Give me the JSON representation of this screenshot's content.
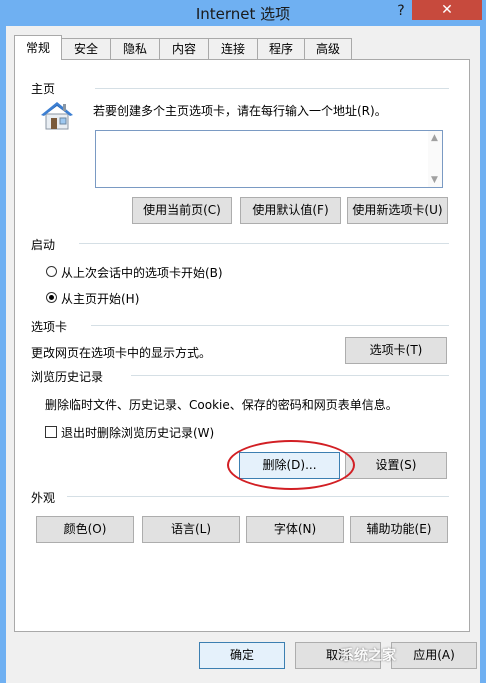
{
  "window": {
    "title": "Internet 选项",
    "help": "?",
    "close": "✕"
  },
  "tabs": [
    {
      "label": "常规",
      "active": true
    },
    {
      "label": "安全"
    },
    {
      "label": "隐私"
    },
    {
      "label": "内容"
    },
    {
      "label": "连接"
    },
    {
      "label": "程序"
    },
    {
      "label": "高级"
    }
  ],
  "homepage": {
    "section": "主页",
    "instruction": "若要创建多个主页选项卡，请在每行输入一个地址(R)。",
    "url_value": "",
    "use_current": "使用当前页(C)",
    "use_default": "使用默认值(F)",
    "use_new_tab": "使用新选项卡(U)"
  },
  "startup": {
    "section": "启动",
    "option_last_session": "从上次会话中的选项卡开始(B)",
    "option_homepage": "从主页开始(H)",
    "selected": "option_homepage"
  },
  "tabs_section": {
    "section": "选项卡",
    "description": "更改网页在选项卡中的显示方式。",
    "button": "选项卡(T)"
  },
  "history": {
    "section": "浏览历史记录",
    "description": "删除临时文件、历史记录、Cookie、保存的密码和网页表单信息。",
    "delete_on_exit": "退出时删除浏览历史记录(W)",
    "delete_on_exit_checked": false,
    "delete_button": "删除(D)...",
    "settings_button": "设置(S)"
  },
  "appearance": {
    "section": "外观",
    "colors": "颜色(O)",
    "languages": "语言(L)",
    "fonts": "字体(N)",
    "accessibility": "辅助功能(E)"
  },
  "footer": {
    "ok": "确定",
    "cancel": "取消",
    "apply": "应用(A)"
  },
  "watermark": "系统之家",
  "colors": {
    "titlebar": "#6fb0f2",
    "close": "#c74a3d",
    "highlight_oval": "#d21f24"
  }
}
